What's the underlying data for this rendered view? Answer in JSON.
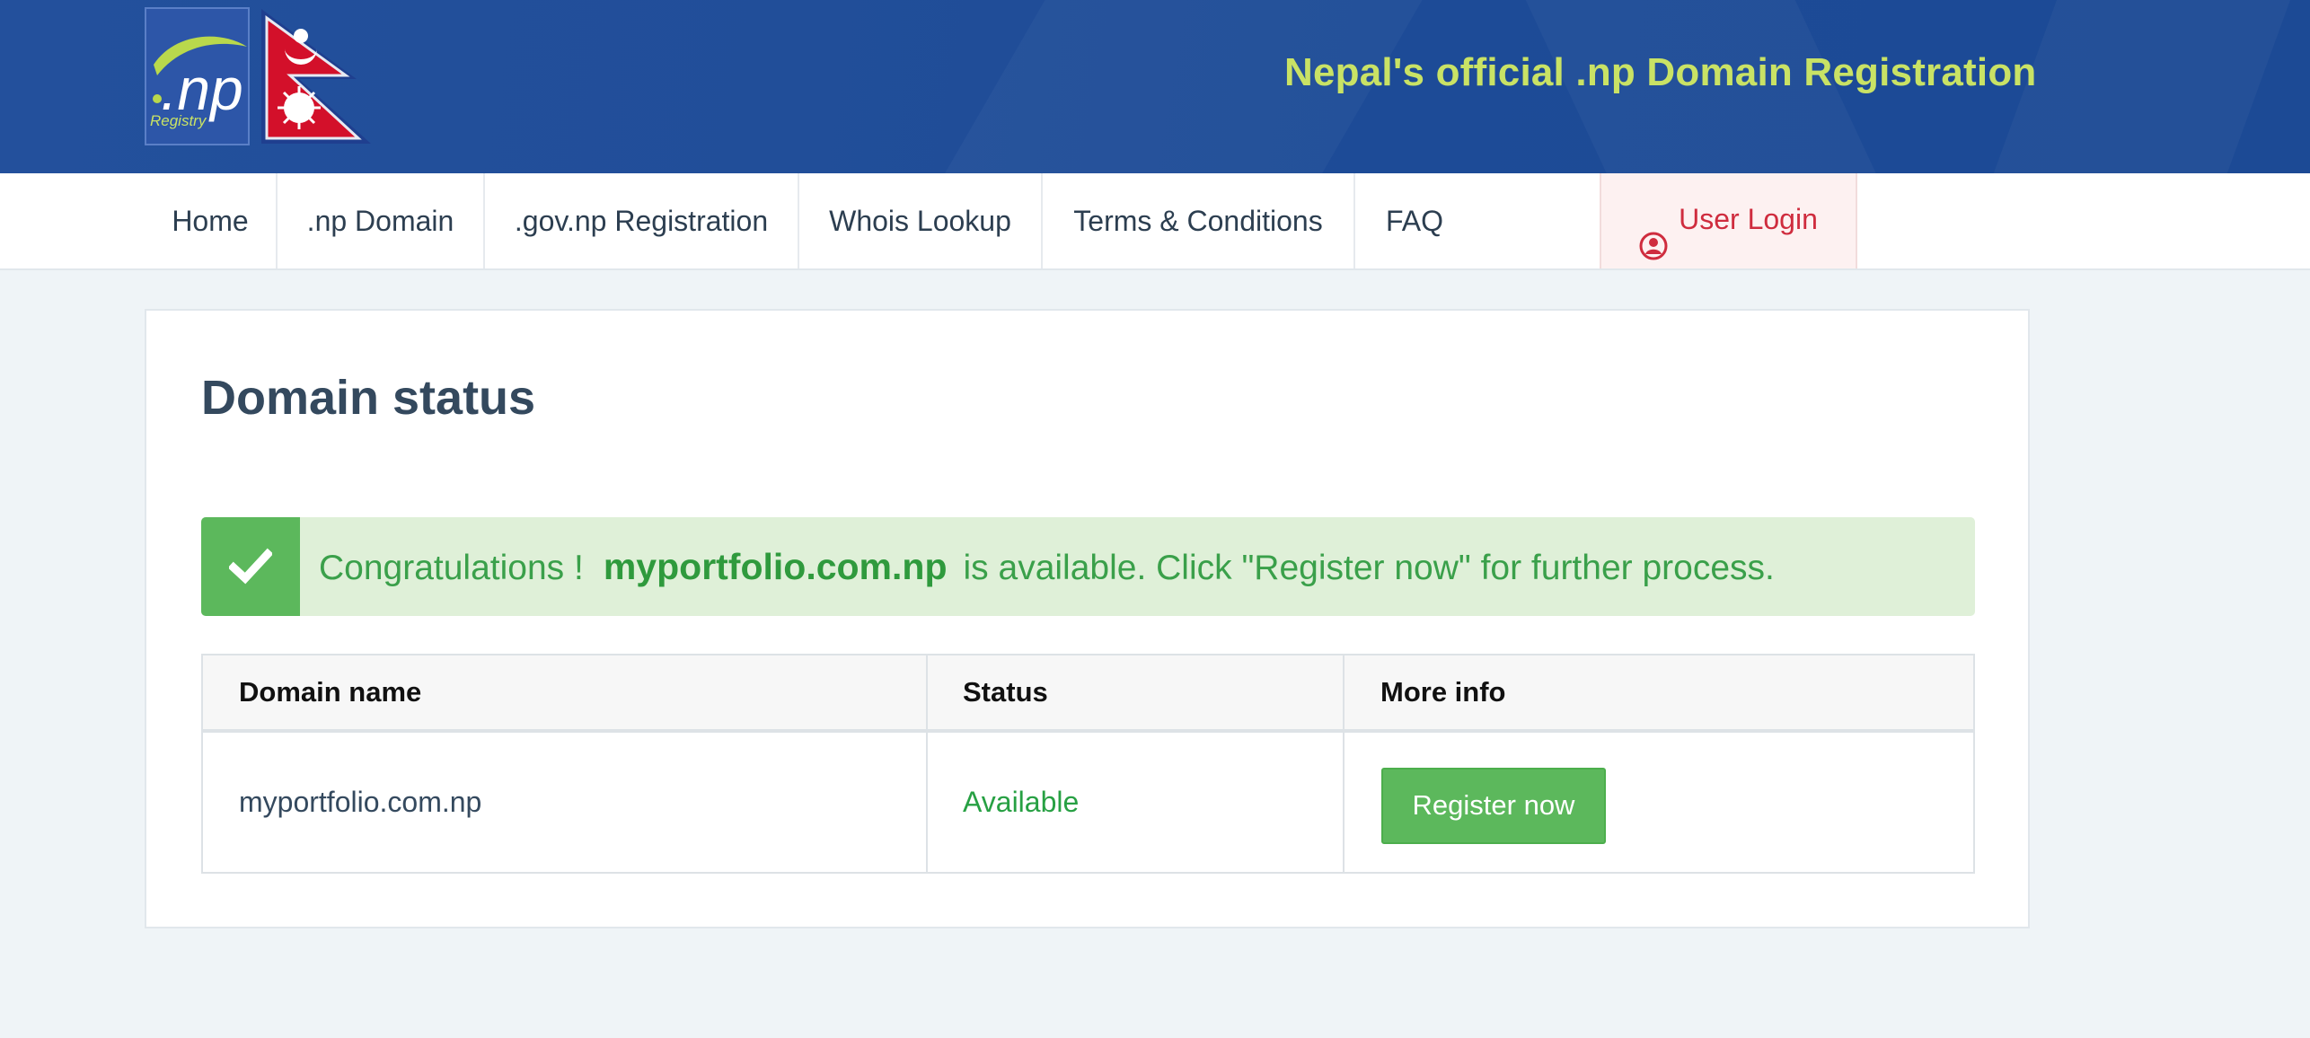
{
  "header": {
    "logo": {
      "text": ".np",
      "subtext": "Registry"
    },
    "title": "Nepal's official .np Domain Registration"
  },
  "nav": {
    "items": [
      {
        "label": "Home"
      },
      {
        "label": ".np Domain"
      },
      {
        "label": ".gov.np Registration"
      },
      {
        "label": "Whois Lookup"
      },
      {
        "label": "Terms & Conditions"
      },
      {
        "label": "FAQ"
      }
    ],
    "user_login": {
      "label": "User Login",
      "icon": "user-circle-icon"
    }
  },
  "main": {
    "title": "Domain status",
    "alert": {
      "icon": "check-icon",
      "prefix": "Congratulations !",
      "domain": "myportfolio.com.np",
      "suffix": "is available. Click \"Register now\" for further process."
    },
    "table": {
      "headers": [
        "Domain name",
        "Status",
        "More info"
      ],
      "rows": [
        {
          "domain": "myportfolio.com.np",
          "status": "Available",
          "action": "Register now"
        }
      ]
    }
  },
  "colors": {
    "header_bg": "#214e99",
    "header_title": "#c9e265",
    "login_accent": "#cf2c3e",
    "success": "#5cb85c",
    "status_text": "#27a043",
    "alert_bg": "#dff0d8"
  }
}
